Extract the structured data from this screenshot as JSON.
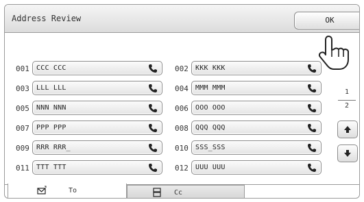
{
  "window": {
    "title": "Address Review",
    "ok_label": "OK"
  },
  "entries": [
    {
      "num": "001",
      "name": "CCC CCC"
    },
    {
      "num": "002",
      "name": "KKK KKK"
    },
    {
      "num": "003",
      "name": "LLL LLL"
    },
    {
      "num": "004",
      "name": "MMM MMM"
    },
    {
      "num": "005",
      "name": "NNN NNN"
    },
    {
      "num": "006",
      "name": "OOO OOO"
    },
    {
      "num": "007",
      "name": "PPP PPP"
    },
    {
      "num": "008",
      "name": "QQQ QQQ"
    },
    {
      "num": "009",
      "name": "RRR RRR_"
    },
    {
      "num": "010",
      "name": "SSS_SSS"
    },
    {
      "num": "011",
      "name": "TTT TTT"
    },
    {
      "num": "012",
      "name": "UUU UUU"
    }
  ],
  "pagination": {
    "current": "1",
    "total": "2"
  },
  "tabs": [
    {
      "label": "To",
      "icon": "envelope-icon"
    },
    {
      "label": "Cc",
      "icon": "cc-address-icon"
    }
  ],
  "icons": {
    "entry_icon": "phone-icon",
    "scroll_up": "arrow-up-icon",
    "scroll_down": "arrow-down-icon",
    "pointer": "hand-pointer-icon"
  }
}
